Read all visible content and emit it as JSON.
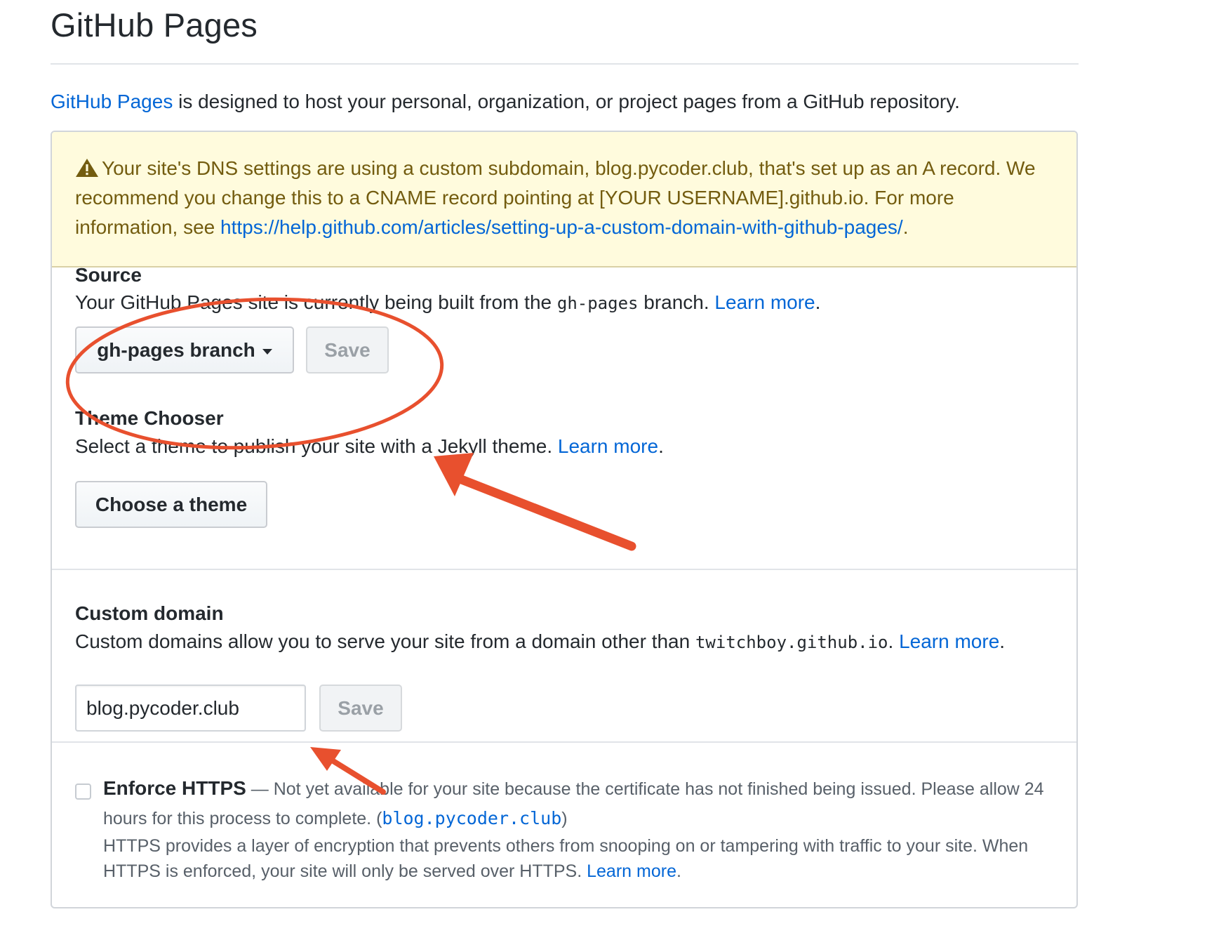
{
  "page": {
    "title": "GitHub Pages",
    "intro_link": "GitHub Pages",
    "intro_text": " is designed to host your personal, organization, or project pages from a GitHub repository."
  },
  "flash": {
    "icon": "alert-icon",
    "text_before_link": "Your site's DNS settings are using a custom subdomain, blog.pycoder.club, that's set up as an A record. We recommend you change this to a CNAME record pointing at [YOUR USERNAME].github.io. For more information, see ",
    "link": "https://help.github.com/articles/setting-up-a-custom-domain-with-github-pages/",
    "text_after_link": "."
  },
  "source": {
    "title": "Source",
    "desc_before": "Your GitHub Pages site is currently being built from the ",
    "branch_code": "gh-pages",
    "desc_after": " branch. ",
    "learn_more": "Learn more",
    "period": ".",
    "branch_select_label": "gh-pages branch",
    "save_label": "Save"
  },
  "theme": {
    "title": "Theme Chooser",
    "desc": "Select a theme to publish your site with a Jekyll theme. ",
    "learn_more": "Learn more",
    "period": ".",
    "button_label": "Choose a theme"
  },
  "custom_domain": {
    "title": "Custom domain",
    "desc_before": "Custom domains allow you to serve your site from a domain other than ",
    "domain_code": "twitchboy.github.io",
    "desc_after": ". ",
    "learn_more": "Learn more",
    "period": ".",
    "input_value": "blog.pycoder.club",
    "save_label": "Save"
  },
  "https": {
    "checked": false,
    "label": "Enforce HTTPS",
    "dash": " — ",
    "status_text": "Not yet available for your site because the certificate has not finished being issued. Please allow 24 hours for this process to complete. (",
    "status_domain": "blog.pycoder.club",
    "status_close": ")",
    "note": "HTTPS provides a layer of encryption that prevents others from snooping on or tampering with traffic to your site. When HTTPS is enforced, your site will only be served over HTTPS. ",
    "learn_more": "Learn more",
    "period": "."
  },
  "annotations": {
    "color": "#e8502e"
  },
  "colors": {
    "link": "#0366d6",
    "flash_bg": "#fffbdd",
    "flash_text": "#735c0f"
  }
}
